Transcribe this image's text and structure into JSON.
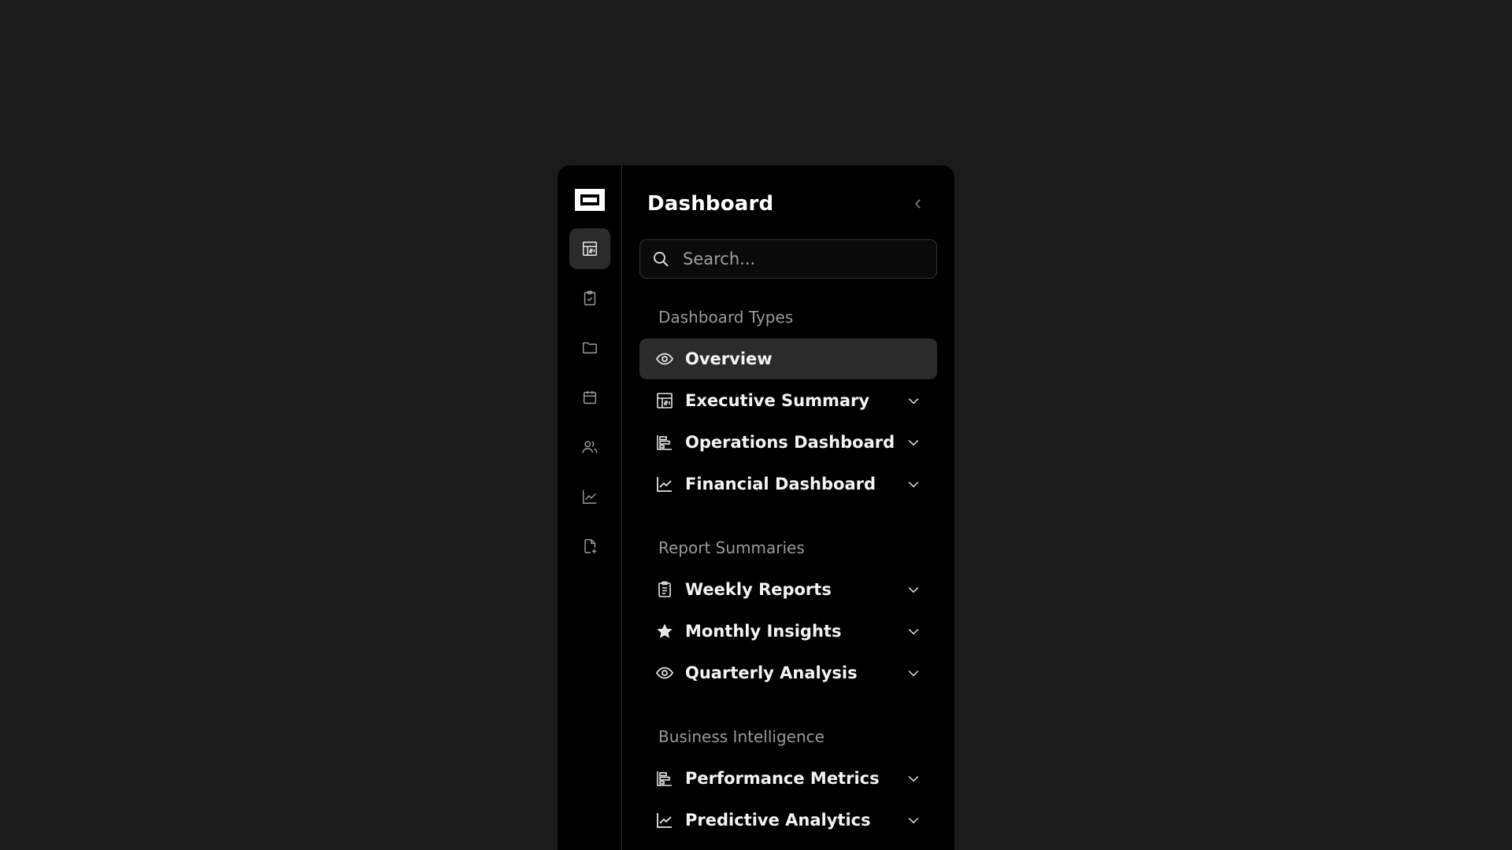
{
  "sidebar": {
    "title": "Dashboard",
    "search": {
      "placeholder": "Search..."
    },
    "rail_icons": [
      "dashboard-icon",
      "clipboard-check-icon",
      "folder-icon",
      "calendar-icon",
      "users-icon",
      "trending-up-icon",
      "file-plus-icon"
    ],
    "sections": [
      {
        "label": "Dashboard Types",
        "items": [
          {
            "label": "Overview",
            "icon": "eye-icon",
            "active": true
          },
          {
            "label": "Executive Summary",
            "icon": "dashboard-icon"
          },
          {
            "label": "Operations Dashboard",
            "icon": "bar-chart-icon"
          },
          {
            "label": "Financial Dashboard",
            "icon": "trending-up-icon"
          }
        ]
      },
      {
        "label": "Report Summaries",
        "items": [
          {
            "label": "Weekly Reports",
            "icon": "clipboard-list-icon"
          },
          {
            "label": "Monthly Insights",
            "icon": "star-icon"
          },
          {
            "label": "Quarterly Analysis",
            "icon": "eye-icon"
          }
        ]
      },
      {
        "label": "Business Intelligence",
        "items": [
          {
            "label": "Performance Metrics",
            "icon": "bar-chart-icon"
          },
          {
            "label": "Predictive Analytics",
            "icon": "trending-up-icon"
          }
        ]
      }
    ]
  },
  "colors": {
    "page_bg": "#1b1b1b",
    "panel_bg": "#000000",
    "active_bg": "#2b2b2b",
    "muted_text": "#9a9a9a"
  }
}
